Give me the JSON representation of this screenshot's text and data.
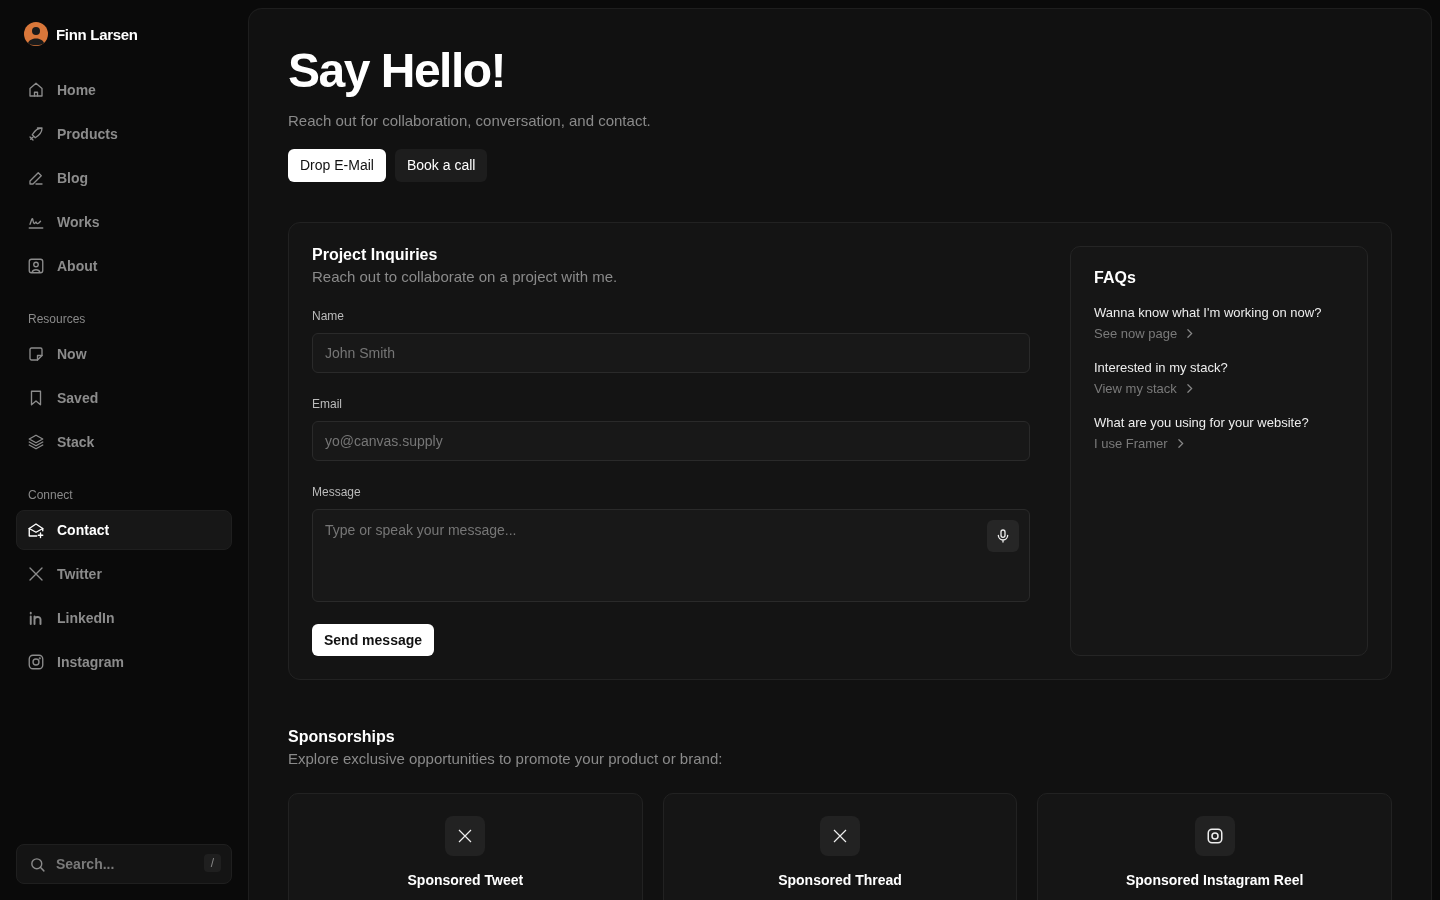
{
  "profile": {
    "name": "Finn Larsen"
  },
  "nav": [
    {
      "label": "Home",
      "selected": false
    },
    {
      "label": "Products",
      "selected": false
    },
    {
      "label": "Blog",
      "selected": false
    },
    {
      "label": "Works",
      "selected": false
    },
    {
      "label": "About",
      "selected": false
    }
  ],
  "resources": {
    "heading": "Resources",
    "items": [
      {
        "label": "Now",
        "selected": false
      },
      {
        "label": "Saved",
        "selected": false
      },
      {
        "label": "Stack",
        "selected": false
      }
    ]
  },
  "connect": {
    "heading": "Connect",
    "items": [
      {
        "label": "Contact",
        "selected": true
      },
      {
        "label": "Twitter",
        "selected": false
      },
      {
        "label": "LinkedIn",
        "selected": false
      },
      {
        "label": "Instagram",
        "selected": false
      }
    ]
  },
  "search": {
    "placeholder": "Search...",
    "shortcut": "/"
  },
  "header": {
    "title": "Say Hello!",
    "subtitle": "Reach out for collaboration, conversation, and contact.",
    "buttons": [
      {
        "label": "Drop E-Mail",
        "selected": true
      },
      {
        "label": "Book a call",
        "selected": false
      }
    ]
  },
  "inquiry": {
    "title": "Project Inquiries",
    "subtitle": "Reach out to collaborate on a project with me.",
    "fields": [
      {
        "kind": "input",
        "label": "Name",
        "placeholder": "John Smith"
      },
      {
        "kind": "input",
        "label": "Email",
        "placeholder": "yo@canvas.supply"
      },
      {
        "kind": "textarea",
        "label": "Message",
        "placeholder": "Type or speak your message..."
      }
    ],
    "submit": "Send message"
  },
  "faqs": {
    "title": "FAQs",
    "items": [
      {
        "question": "Wanna know what I'm working on now?",
        "link": "See now page"
      },
      {
        "question": "Interested in my stack?",
        "link": "View my stack"
      },
      {
        "question": "What are you using for your website?",
        "link": "I use Framer"
      }
    ]
  },
  "sponsorships": {
    "title": "Sponsorships",
    "subtitle": "Explore exclusive opportunities to promote your product or brand:",
    "cards": [
      {
        "kind": "x",
        "title": "Sponsored Tweet"
      },
      {
        "kind": "x",
        "title": "Sponsored Thread"
      },
      {
        "kind": "instagram",
        "title": "Sponsored Instagram Reel"
      }
    ]
  }
}
